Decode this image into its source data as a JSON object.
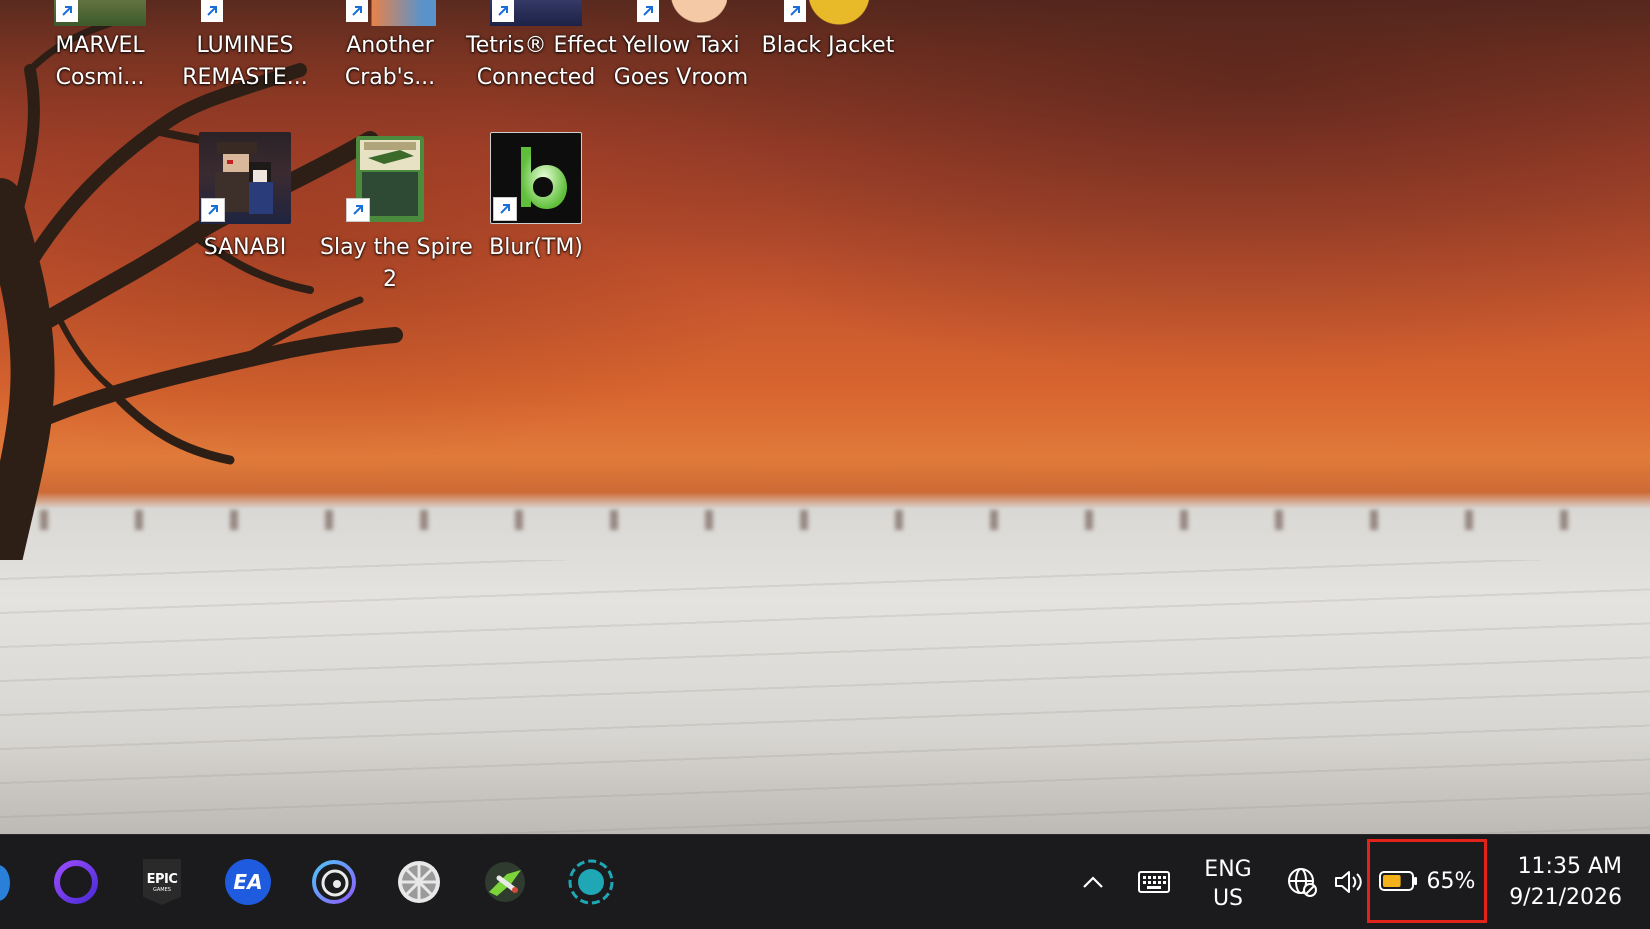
{
  "desktop": {
    "icons_top_row": [
      {
        "name": "MARVEL Cosmi...",
        "line1": "MARVEL",
        "line2": "Cosmi...",
        "icon": "marvel-cosmic-icon"
      },
      {
        "name": "LUMINES REMASTE...",
        "line1": "LUMINES",
        "line2": "REMASTE...",
        "icon": "lumines-icon"
      },
      {
        "name": "Another Crab's...",
        "line1": "Another",
        "line2": "Crab's...",
        "icon": "another-crab-icon"
      },
      {
        "name": "Tetris® Effect Connected",
        "line1": "Tetris® Effect",
        "line2": "Connected",
        "icon": "tetris-effect-icon"
      },
      {
        "name": "Yellow Taxi Goes Vroom",
        "line1": "Yellow Taxi",
        "line2": "Goes Vroom",
        "icon": "yellow-taxi-icon"
      },
      {
        "name": "Black Jacket",
        "line1": "Black Jacket",
        "line2": "",
        "icon": "black-jacket-icon"
      }
    ],
    "icons_second_row": [
      {
        "line1": "SANABI",
        "line2": "",
        "icon": "sanabi-icon"
      },
      {
        "line1": "Slay the Spire",
        "line2": "2",
        "icon": "slay-the-spire-icon"
      },
      {
        "line1": "Blur(TM)",
        "line2": "",
        "icon": "blur-icon"
      }
    ]
  },
  "taskbar": {
    "apps": [
      {
        "name": "cortana",
        "icon": "cortana-ring-icon"
      },
      {
        "name": "epic-games",
        "icon": "epic-games-icon",
        "text": "EPIC"
      },
      {
        "name": "ea-app",
        "icon": "ea-icon",
        "text": "EA"
      },
      {
        "name": "ubisoft-connect",
        "icon": "ubisoft-swirl-icon"
      },
      {
        "name": "aperture-app",
        "icon": "aperture-icon"
      },
      {
        "name": "nvidia-app",
        "icon": "green-logo-icon"
      },
      {
        "name": "teal-circle-app",
        "icon": "teal-circle-icon"
      }
    ],
    "tray": {
      "overflow_icon": "chevron-up-icon",
      "keyboard_icon": "keyboard-icon",
      "lang_line1": "ENG",
      "lang_line2": "US",
      "network_icon": "globe-no-internet-icon",
      "volume_icon": "speaker-icon",
      "battery_percent_label": "65%",
      "battery_level": 0.65,
      "battery_color": "#f3b21b",
      "time": "11:35 AM",
      "date": "9/21/2026"
    },
    "highlight_color": "#e2231a"
  }
}
